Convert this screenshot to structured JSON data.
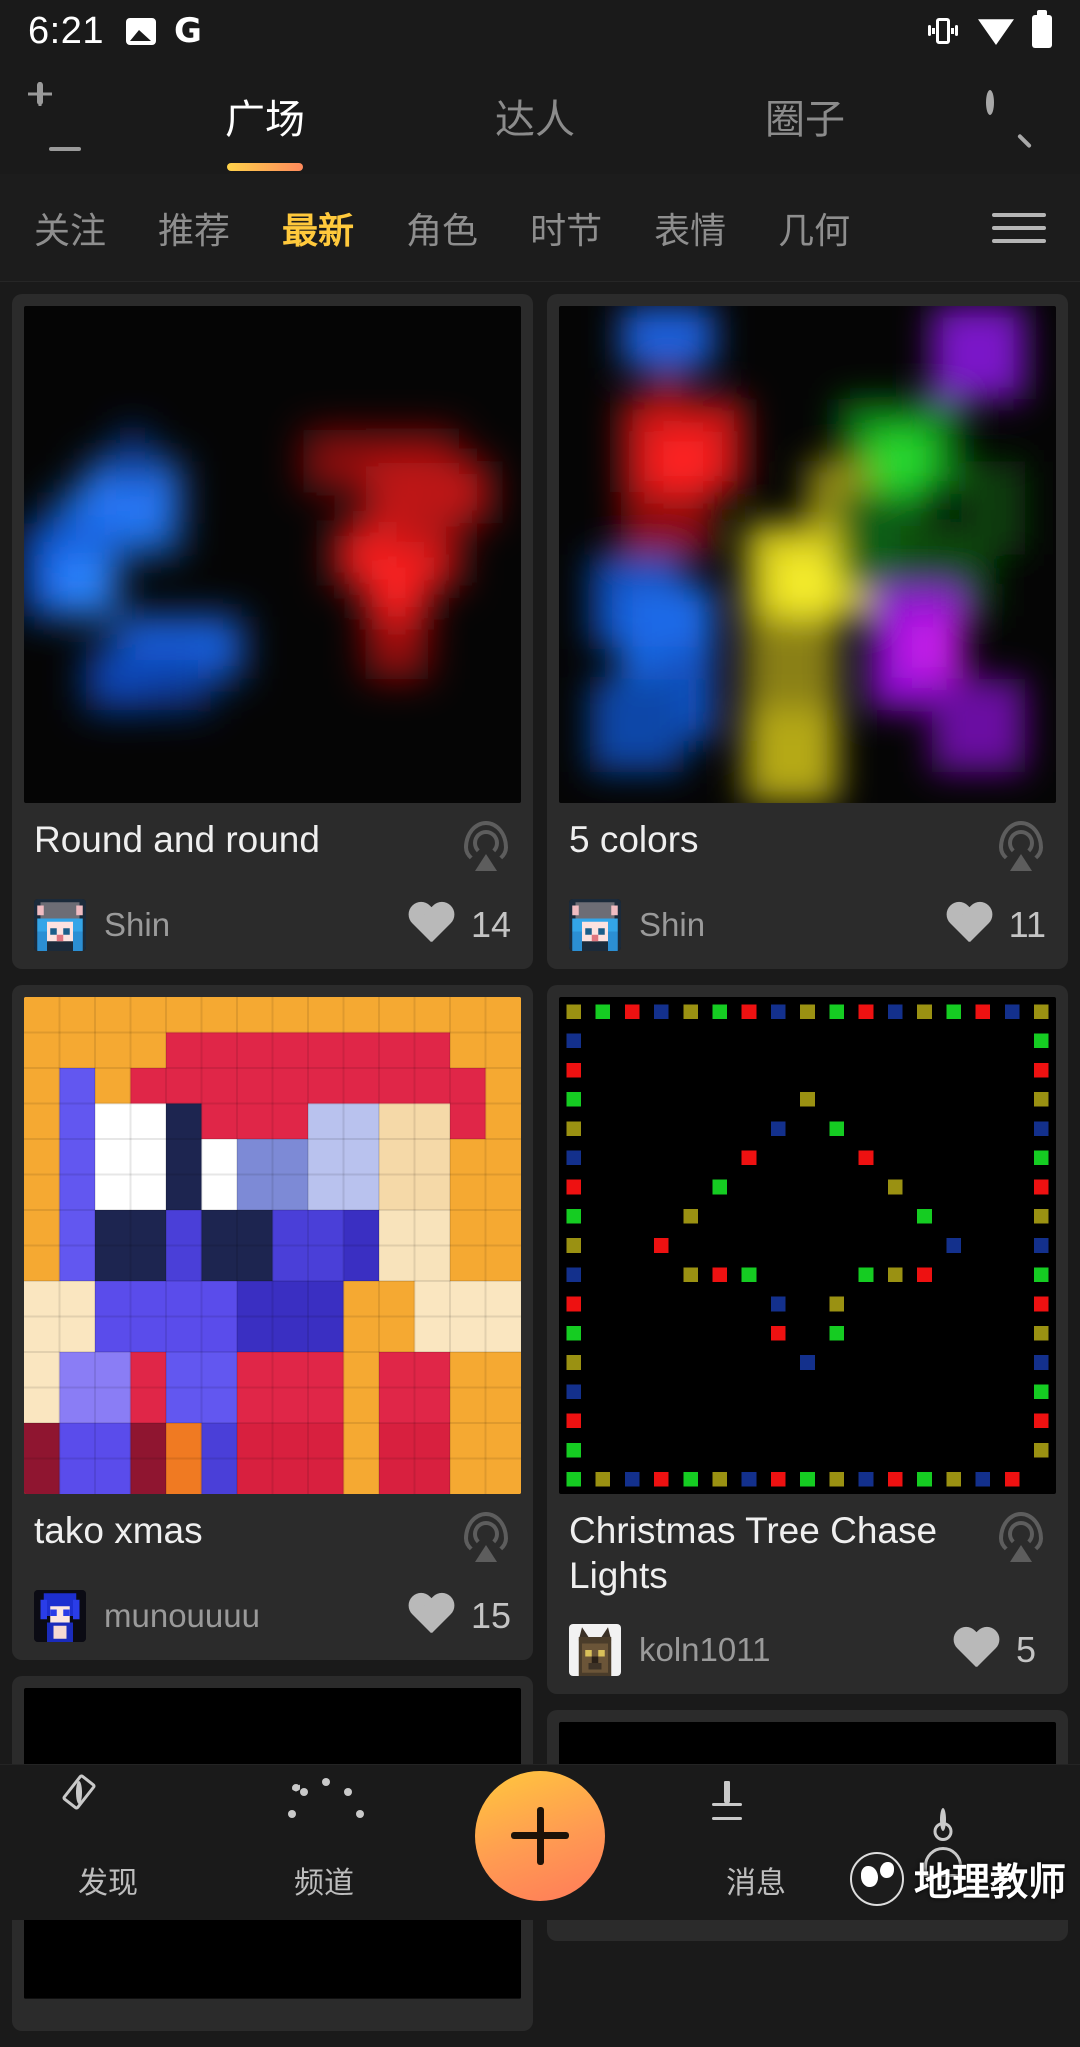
{
  "status_bar": {
    "time": "6:21",
    "left_icons": [
      "photo-icon",
      "google-icon"
    ],
    "right_icons": [
      "vibrate-icon",
      "wifi-icon",
      "battery-icon"
    ]
  },
  "top_nav": {
    "add_device_icon": "add-device-icon",
    "search_icon": "search-icon",
    "tabs": [
      {
        "label": "广场",
        "active": true
      },
      {
        "label": "达人",
        "active": false
      },
      {
        "label": "圈子",
        "active": false
      }
    ],
    "active_underline_color": "#ffd24a"
  },
  "filters": {
    "chips": [
      {
        "label": "关注",
        "active": false
      },
      {
        "label": "推荐",
        "active": false
      },
      {
        "label": "最新",
        "active": true
      },
      {
        "label": "角色",
        "active": false
      },
      {
        "label": "时节",
        "active": false
      },
      {
        "label": "表情",
        "active": false
      },
      {
        "label": "几何",
        "active": false
      }
    ],
    "menu_icon": "hamburger-menu-icon",
    "active_color": "#ffc93c"
  },
  "feed": {
    "cards": [
      {
        "title": "Round and round",
        "author": "Shin",
        "likes": "14",
        "art": "led-glow-blue-red",
        "broadcast_icon": "broadcast-icon",
        "like_icon": "heart-icon",
        "avatar": "avatar-shin"
      },
      {
        "title": "5 colors",
        "author": "Shin",
        "likes": "11",
        "art": "led-glow-five-colors",
        "broadcast_icon": "broadcast-icon",
        "like_icon": "heart-icon",
        "avatar": "avatar-shin"
      },
      {
        "title": "tako xmas",
        "author": "munouuuu",
        "likes": "15",
        "art": "pixelart-tako-xmas",
        "broadcast_icon": "broadcast-icon",
        "like_icon": "heart-icon",
        "avatar": "avatar-munouuuu"
      },
      {
        "title": "Christmas Tree Chase Lights",
        "author": "koln1011",
        "likes": "5",
        "art": "led-christmas-tree",
        "broadcast_icon": "broadcast-icon",
        "like_icon": "heart-icon",
        "avatar": "avatar-koln1011"
      },
      {
        "title": "",
        "author": "",
        "likes": "",
        "art": "led-black-partial",
        "broadcast_icon": "broadcast-icon",
        "like_icon": "heart-icon",
        "avatar": ""
      },
      {
        "title": "",
        "author": "",
        "likes": "",
        "art": "pixelart-skin-partial",
        "broadcast_icon": "broadcast-icon",
        "like_icon": "heart-icon",
        "avatar": ""
      }
    ]
  },
  "bottom_nav": {
    "items": [
      {
        "label": "发现",
        "icon": "compass-icon"
      },
      {
        "label": "频道",
        "icon": "gauge-icon"
      },
      {
        "label": "",
        "icon": "plus-fab-icon"
      },
      {
        "label": "消息",
        "icon": "message-icon"
      },
      {
        "label": "",
        "icon": "profile-icon"
      }
    ],
    "fab_gradient": [
      "#ffc83d",
      "#ff7a5a"
    ]
  },
  "watermark": {
    "text": "地理教师",
    "logo": "globe-logo"
  }
}
